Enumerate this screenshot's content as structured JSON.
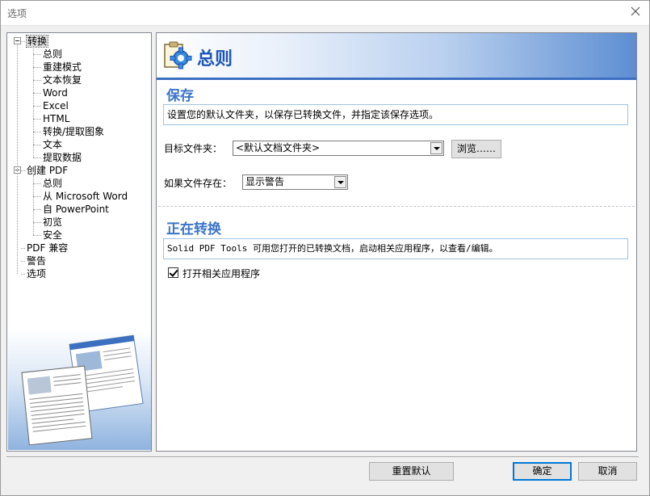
{
  "window": {
    "title": "选项"
  },
  "tree": [
    {
      "label": "转换",
      "level": 0,
      "expanded": true,
      "selected": true
    },
    {
      "label": "总则",
      "level": 1
    },
    {
      "label": "重建模式",
      "level": 1
    },
    {
      "label": "文本恢复",
      "level": 1
    },
    {
      "label": "Word",
      "level": 1
    },
    {
      "label": "Excel",
      "level": 1
    },
    {
      "label": "HTML",
      "level": 1
    },
    {
      "label": "转换/提取图象",
      "level": 1
    },
    {
      "label": "文本",
      "level": 1
    },
    {
      "label": "提取数据",
      "level": 1
    },
    {
      "label": "创建 PDF",
      "level": 0,
      "expanded": true
    },
    {
      "label": "总则",
      "level": 1
    },
    {
      "label": "从 Microsoft Word",
      "level": 1
    },
    {
      "label": "自 PowerPoint",
      "level": 1
    },
    {
      "label": "初览",
      "level": 1
    },
    {
      "label": "安全",
      "level": 1
    },
    {
      "label": "PDF 兼容",
      "level": 0
    },
    {
      "label": "警告",
      "level": 0
    },
    {
      "label": "选项",
      "level": 0
    }
  ],
  "header": {
    "title": "总则",
    "icon": "settings-gear-icon"
  },
  "save_section": {
    "title": "保存",
    "description": "设置您的默认文件夹，以保存已转换文件，并指定该保存选项。",
    "target_folder_label": "目标文件夹：",
    "target_folder_value": "<默认文档文件夹>",
    "browse_label": "浏览……",
    "if_exists_label": "如果文件存在：",
    "if_exists_value": "显示警告"
  },
  "converting_section": {
    "title": "正在转换",
    "description": "Solid PDF Tools 可用您打开的已转换文档，启动相关应用程序，以查看/编辑。",
    "open_app_label": "打开相关应用程序",
    "open_app_checked": true
  },
  "footer": {
    "reset_label": "重置默认",
    "ok_label": "确定",
    "cancel_label": "取消"
  },
  "colors": {
    "accent": "#1d55b8",
    "section": "#3a74c9",
    "focus": "#0078d7"
  }
}
